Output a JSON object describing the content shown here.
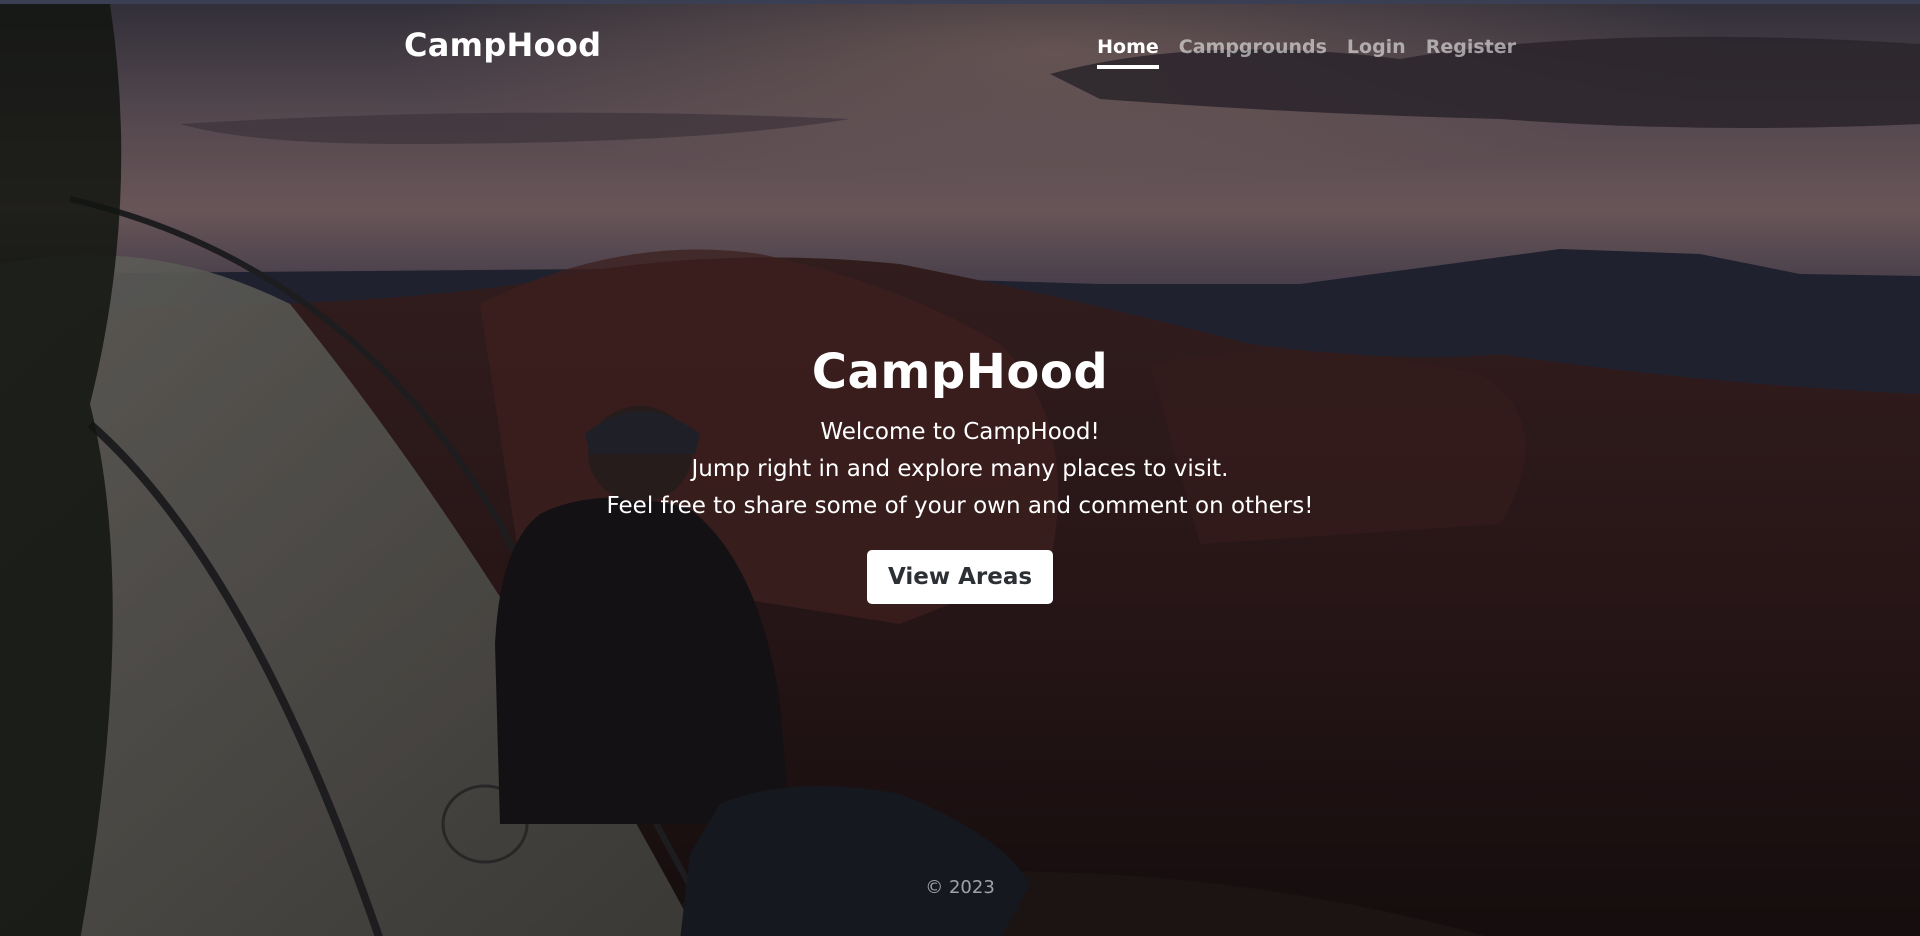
{
  "header": {
    "brand": "CampHood",
    "nav": [
      {
        "label": "Home",
        "active": true
      },
      {
        "label": "Campgrounds",
        "active": false
      },
      {
        "label": "Login",
        "active": false
      },
      {
        "label": "Register",
        "active": false
      }
    ]
  },
  "hero": {
    "title": "CampHood",
    "lines": [
      "Welcome to CampHood!",
      "Jump right in and explore many places to visit.",
      "Feel free to share some of your own and comment on others!"
    ],
    "cta_label": "View Areas"
  },
  "footer": {
    "copyright": "© 2023"
  },
  "colors": {
    "text_primary": "#ffffff",
    "text_muted": "rgba(255,255,255,0.55)",
    "button_bg": "#ffffff",
    "button_text": "#2c2f33",
    "top_border": "#3b3f54"
  },
  "background": {
    "description_icon": "campsite-photo"
  }
}
